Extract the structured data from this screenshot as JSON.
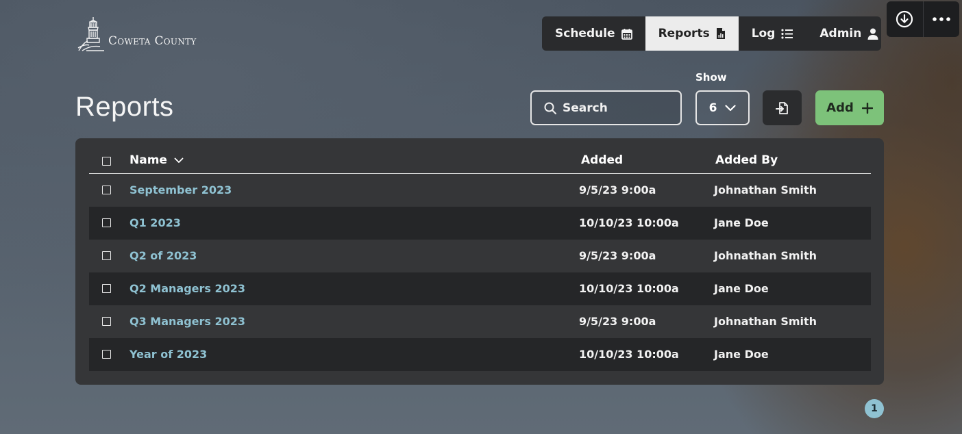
{
  "window_controls": {
    "download_icon": "download-circle-icon",
    "more_icon": "more-horizontal-icon"
  },
  "logo": {
    "text": "Coweta County",
    "icon": "courthouse-logo-icon"
  },
  "nav": {
    "items": [
      {
        "label": "Schedule",
        "icon": "calendar-icon",
        "active": false
      },
      {
        "label": "Reports",
        "icon": "file-report-icon",
        "active": true
      },
      {
        "label": "Log",
        "icon": "list-icon",
        "active": false
      },
      {
        "label": "Admin",
        "icon": "user-icon",
        "active": false
      }
    ]
  },
  "page": {
    "title": "Reports"
  },
  "toolbar": {
    "search_placeholder": "Search",
    "show_label": "Show",
    "show_value": "6",
    "add_label": "Add"
  },
  "table": {
    "columns": {
      "name": "Name",
      "added": "Added",
      "added_by": "Added By"
    },
    "rows": [
      {
        "name": "September 2023",
        "added": "9/5/23 9:00a",
        "added_by": "Johnathan Smith"
      },
      {
        "name": "Q1 2023",
        "added": "10/10/23 10:00a",
        "added_by": "Jane Doe"
      },
      {
        "name": "Q2 of 2023",
        "added": "9/5/23 9:00a",
        "added_by": "Johnathan Smith"
      },
      {
        "name": "Q2 Managers 2023",
        "added": "10/10/23 10:00a",
        "added_by": "Jane Doe"
      },
      {
        "name": "Q3 Managers 2023",
        "added": "9/5/23 9:00a",
        "added_by": "Johnathan Smith"
      },
      {
        "name": "Year of 2023",
        "added": "10/10/23 10:00a",
        "added_by": "Jane Doe"
      }
    ]
  },
  "pagination": {
    "current_page": "1"
  },
  "colors": {
    "accent_green": "#7dc27a",
    "link_blue": "#8fc2d2",
    "panel": "#353638",
    "row_alt": "#252628"
  }
}
